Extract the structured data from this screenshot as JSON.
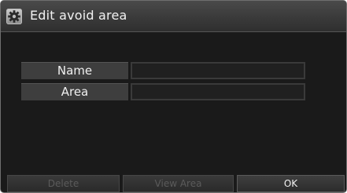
{
  "header": {
    "title": "Edit avoid area",
    "icon": "gear-icon"
  },
  "form": {
    "fields": [
      {
        "label": "Name",
        "value": ""
      },
      {
        "label": "Area",
        "value": ""
      }
    ]
  },
  "buttons": {
    "delete": {
      "label": "Delete",
      "enabled": false
    },
    "view_area": {
      "label": "View Area",
      "enabled": false
    },
    "ok": {
      "label": "OK",
      "enabled": true
    }
  },
  "colors": {
    "background": "#1a1a1a",
    "titlebar": "#3a3a3a",
    "label_bg": "#3e3e3e",
    "text": "#f0f0f0",
    "disabled_text": "#5b5b5b"
  }
}
